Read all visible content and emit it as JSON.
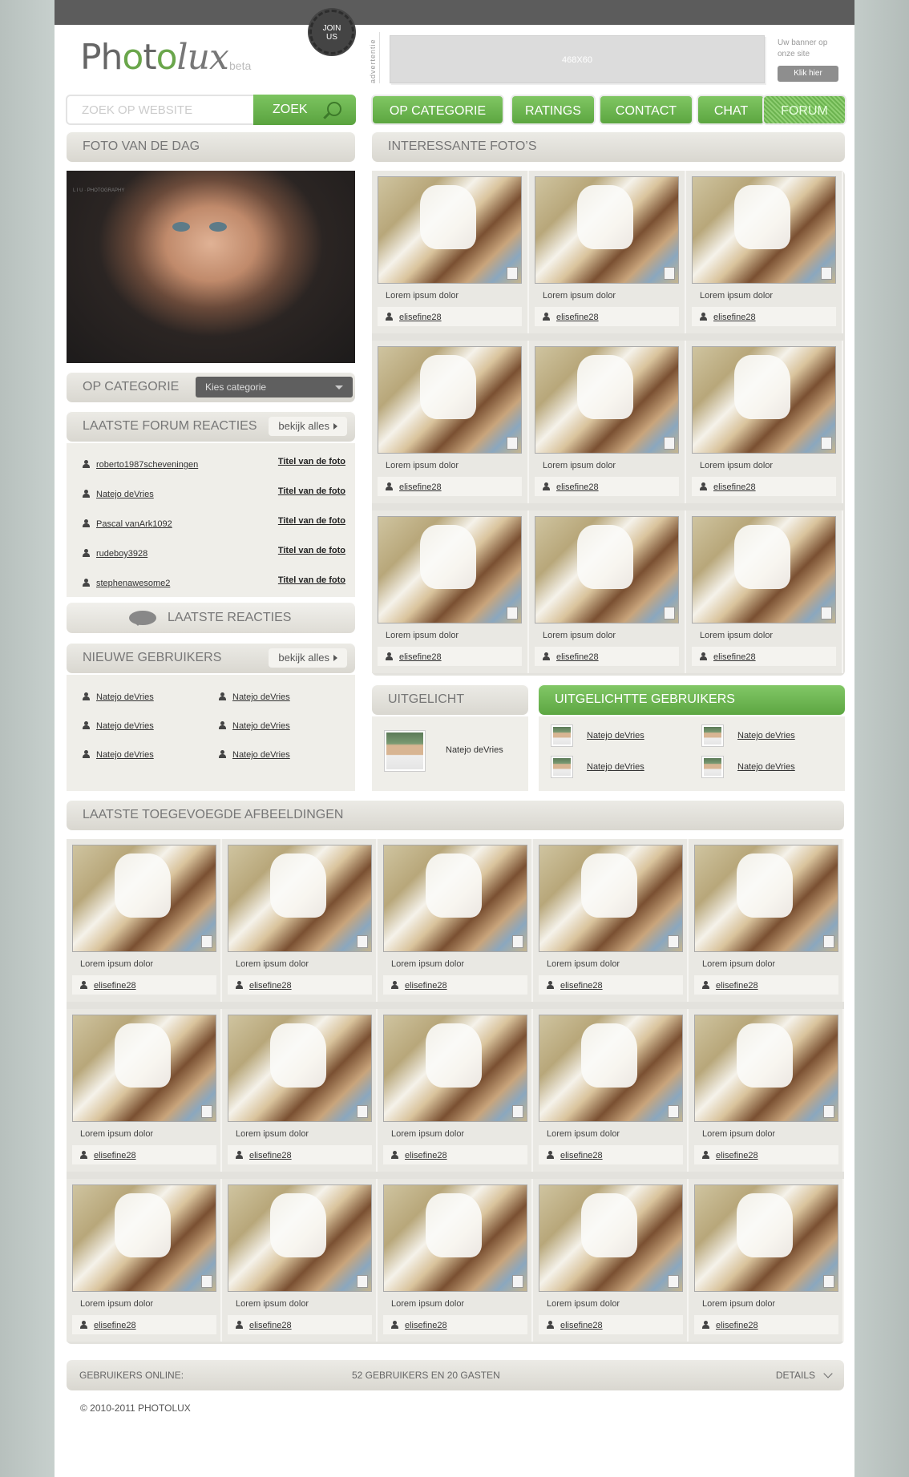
{
  "header": {
    "logo_text": "Photolux",
    "logo_beta": "beta",
    "join_line1": "JOIN",
    "join_line2": "US",
    "ad_label": "advertentie",
    "banner_size": "468X60",
    "banner_text": "Uw banner op onze site",
    "banner_button": "Klik hier"
  },
  "search": {
    "placeholder": "ZOEK OP WEBSITE",
    "button": "ZOEK"
  },
  "nav": [
    {
      "label": "OP CATEGORIE"
    },
    {
      "label": "RATINGS"
    },
    {
      "label": "CONTACT"
    },
    {
      "label": "CHAT"
    },
    {
      "label": "FORUM"
    }
  ],
  "sidebar": {
    "foto_title": "FOTO VAN DE DAG",
    "foto_watermark": "L I U · PHOTOGRAPHY",
    "cat_title": "OP CATEGORIE",
    "cat_select": "Kies categorie",
    "forum_title": "LAATSTE FORUM REACTIES",
    "view_all": "bekijk alles",
    "forum_rows": [
      {
        "user": "roberto1987scheveningen",
        "title": "Titel van de foto"
      },
      {
        "user": "Natejo deVries",
        "title": "Titel van de foto"
      },
      {
        "user": "Pascal vanArk1092",
        "title": "Titel van de foto"
      },
      {
        "user": "rudeboy3928",
        "title": "Titel van de foto"
      },
      {
        "user": "stephenawesome2",
        "title": "Titel van de foto"
      }
    ],
    "reacties_label": "LAATSTE REACTIES",
    "new_users_title": "NIEUWE GEBRUIKERS",
    "new_users": [
      "Natejo deVries",
      "Natejo deVries",
      "Natejo deVries",
      "Natejo deVries",
      "Natejo deVries",
      "Natejo deVries"
    ]
  },
  "interesting": {
    "title": "INTERESSANTE FOTO’S",
    "caption": "Lorem ipsum dolor",
    "user": "elisefine28"
  },
  "uitgelicht": {
    "title": "UITGELICHT",
    "name": "Natejo deVries"
  },
  "featured_users": {
    "title": "UITGELICHTTE GEBRUIKERS",
    "users": [
      "Natejo deVries",
      "Natejo deVries",
      "Natejo deVries",
      "Natejo deVries"
    ]
  },
  "latest": {
    "title": "LAATSTE TOEGEVOEGDE AFBEELDINGEN",
    "caption": "Lorem ipsum dolor",
    "user": "elisefine28"
  },
  "footer": {
    "online_label": "GEBRUIKERS ONLINE:",
    "online_count": "52 GEBRUIKERS EN 20 GASTEN",
    "details": "DETAILS",
    "copyright": "© 2010-2011 PHOTOLUX"
  }
}
